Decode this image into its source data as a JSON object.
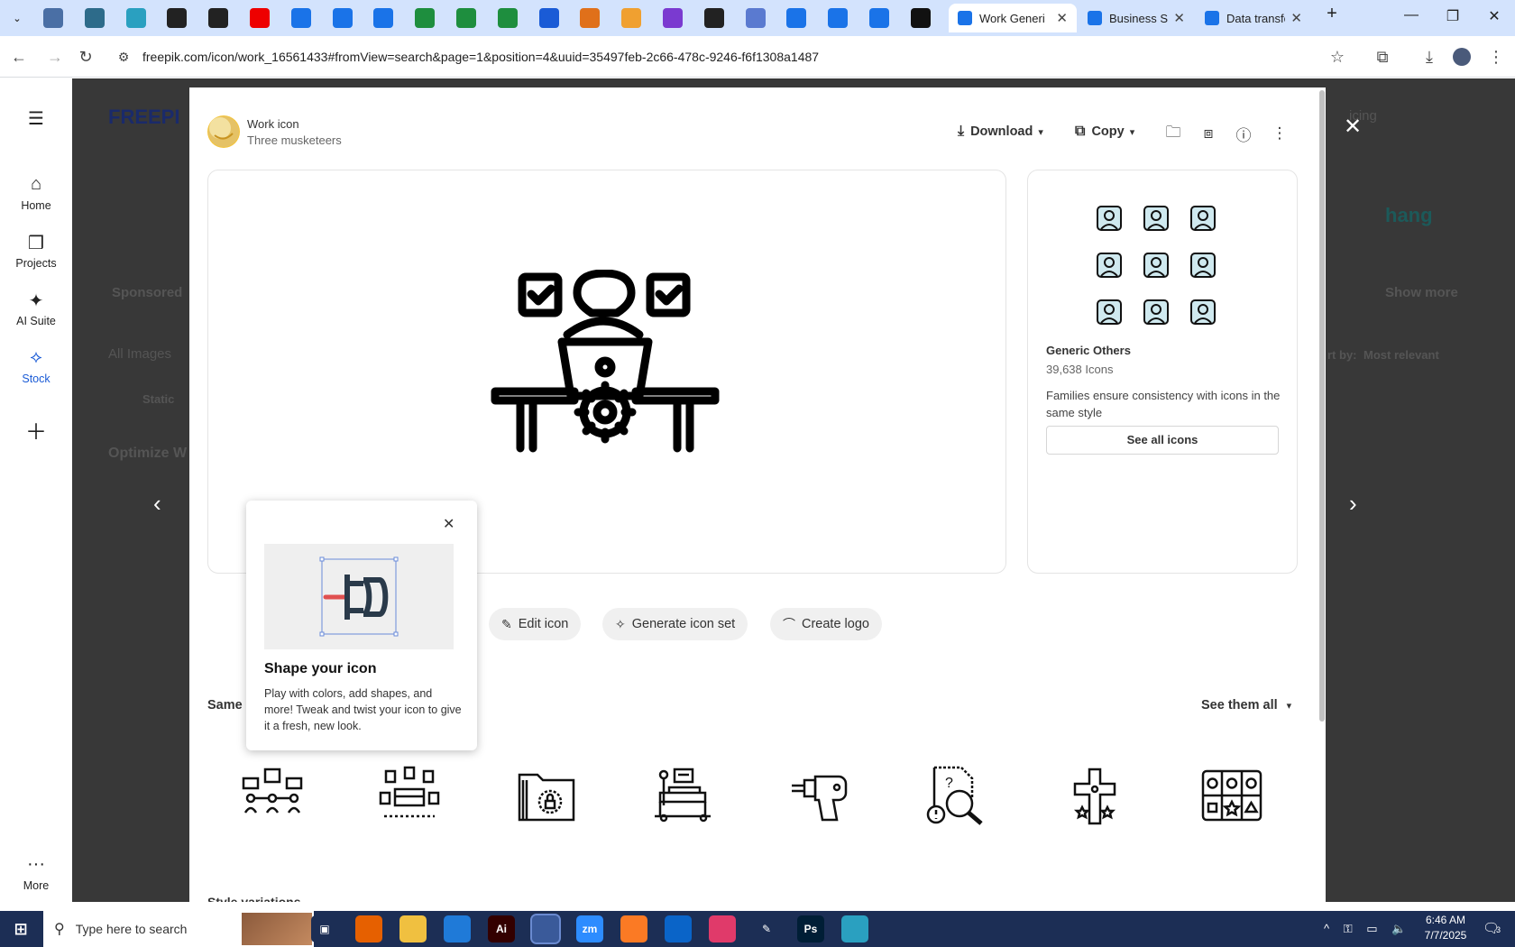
{
  "browser": {
    "tabs_pinned_icons": [
      "globe-icon",
      "vpn-icon",
      "ai-icon",
      "openai-icon",
      "bolt-icon",
      "youtube-icon",
      "docs-icon",
      "docs-icon",
      "docs-icon",
      "sheets-icon",
      "sheets-icon",
      "sheets-icon",
      "mailchimp-icon",
      "xampp-icon",
      "fox-icon",
      "code-icon",
      "ai-code-icon",
      "grid-icon",
      "forms-icon",
      "forms-icon",
      "forms-icon",
      "medium-icon"
    ],
    "tabs": [
      {
        "title": "Work Generi",
        "active": true
      },
      {
        "title": "Business Su",
        "active": false
      },
      {
        "title": "Data transfe",
        "active": false
      }
    ],
    "new_tab": "+",
    "url": "freepik.com/icon/work_16561433#fromView=search&page=1&position=4&uuid=35497feb-2c66-478c-9246-f6f1308a1487"
  },
  "sidebar": {
    "items": [
      {
        "label": "Home",
        "icon": "home-icon"
      },
      {
        "label": "Projects",
        "icon": "projects-icon"
      },
      {
        "label": "AI Suite",
        "icon": "sparkle-icon"
      },
      {
        "label": "Stock",
        "icon": "stock-icon"
      },
      {
        "label": "More",
        "icon": "more-icon"
      }
    ]
  },
  "background": {
    "sponsored": "Sponsored",
    "all_images": "All Images",
    "static": "Static",
    "optimize": "Optimize W",
    "sort_by": "rt by:",
    "most_relevant": "Most relevant",
    "show_more": "Show more",
    "pricing": "icing"
  },
  "modal": {
    "author_title": "Work icon",
    "author_name": "Three musketeers",
    "download": "Download",
    "copy": "Copy",
    "family": {
      "name": "Generic Others",
      "count": "39,638 Icons",
      "description": "Families ensure consistency with icons in the same style",
      "see_all": "See all icons"
    },
    "actions": {
      "edit": "Edit icon",
      "generate": "Generate icon set",
      "logo": "Create logo"
    },
    "same_style": "Same s",
    "see_them_all": "See them all",
    "style_variations": "Style variations"
  },
  "tooltip": {
    "title": "Shape your icon",
    "body": "Play with colors, add shapes, and more! Tweak and twist your icon to give it a fresh, new look."
  },
  "taskbar": {
    "search_placeholder": "Type here to search",
    "time": "6:46 AM",
    "date": "7/7/2025",
    "notifications": "3"
  },
  "colors": {
    "tab_strip": "#d3e3fd",
    "taskbar": "#1c2e55",
    "accent_blue": "#1a73e8",
    "stock_active": "#1a5bd6"
  }
}
